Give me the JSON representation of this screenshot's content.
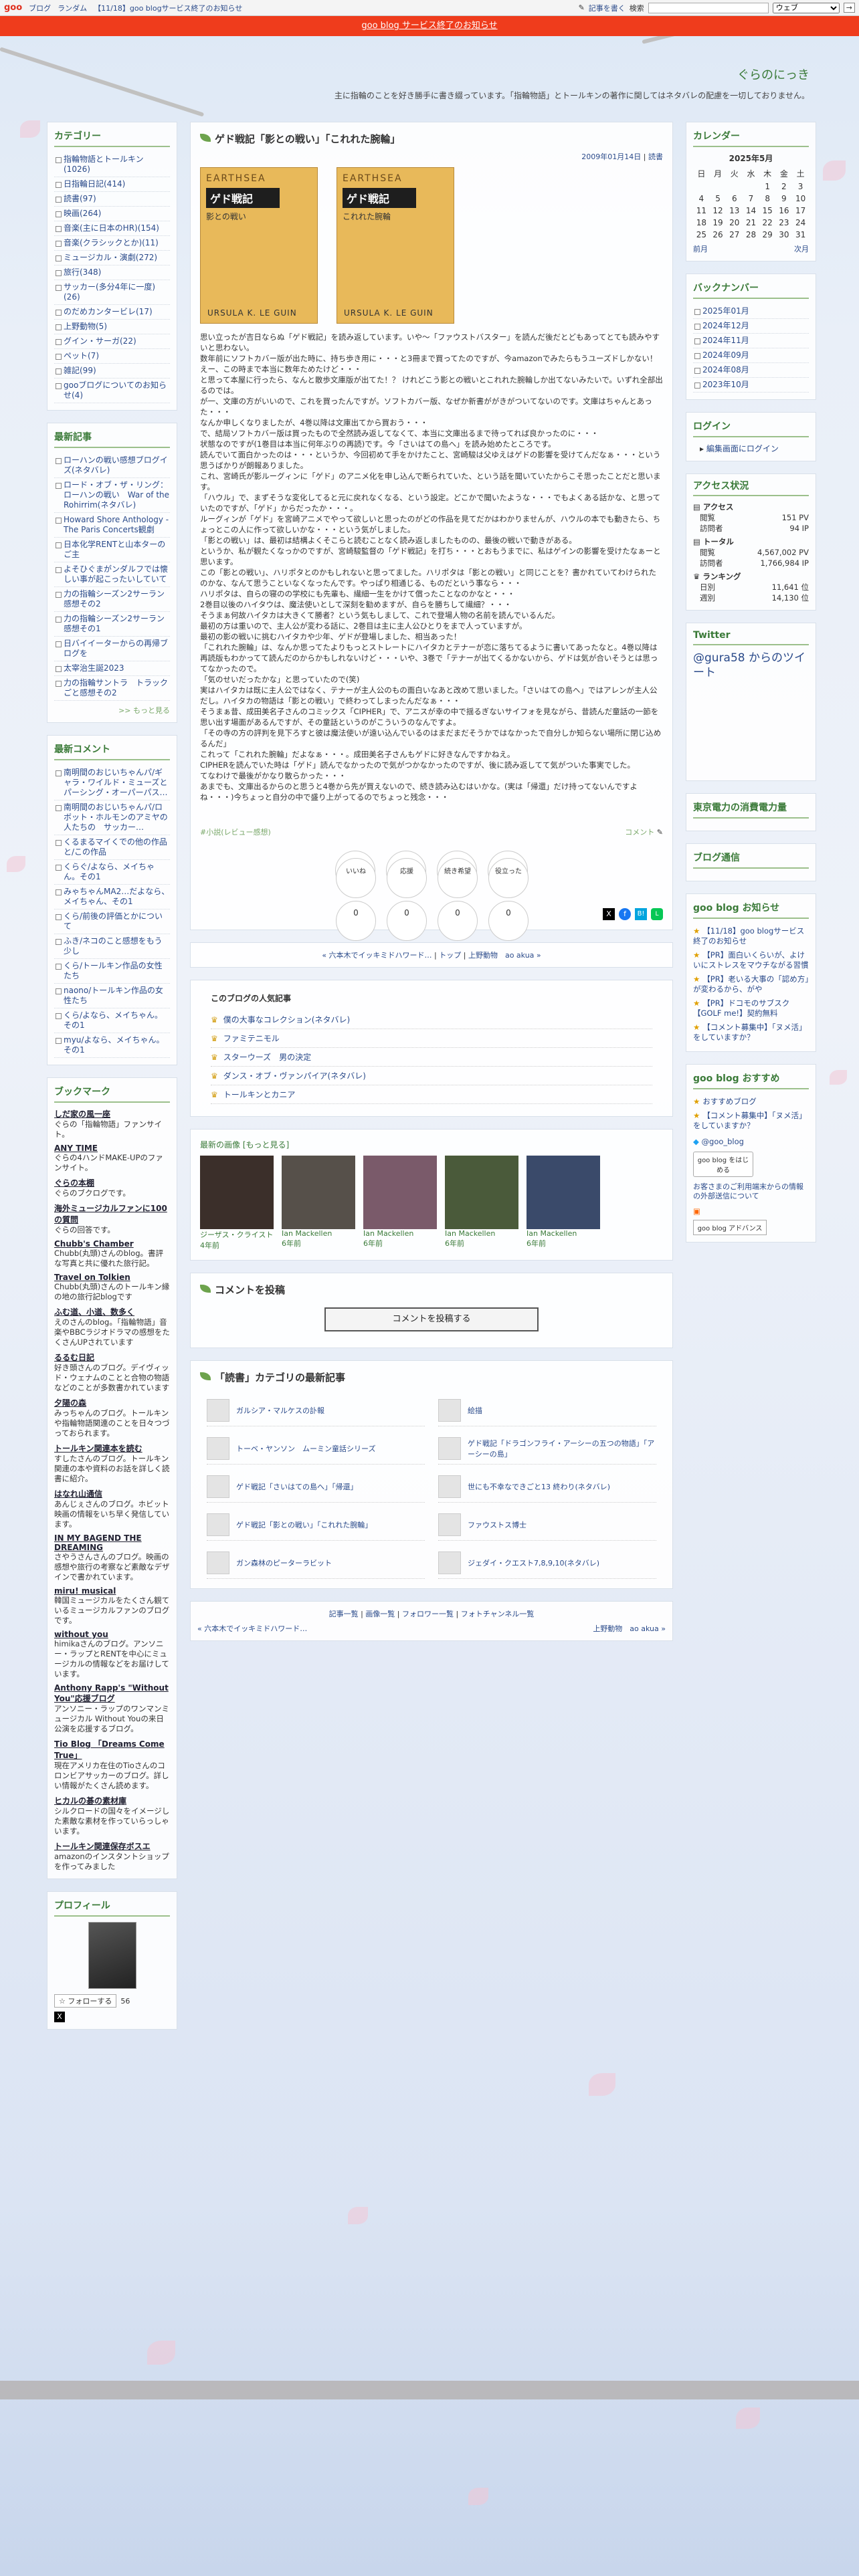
{
  "topbar": {
    "logo": "goo",
    "links": [
      "ブログ",
      "ランダム"
    ],
    "notice": "【11/18】goo blogサービス終了のお知らせ",
    "write": "記事を書く",
    "search_label": "検索",
    "search_scope": "ウェブ",
    "search_button": "→"
  },
  "banner": "goo blog サービス終了のお知らせ",
  "blog": {
    "title": "ぐらのにっき",
    "desc": "主に指輪のことを好き勝手に書き綴っています。「指輪物語」とトールキンの著作に関してはネタバレの配慮を一切しておりません。"
  },
  "categories": {
    "title": "カテゴリー",
    "items": [
      "指輪物語とトールキン(1026)",
      "日指輪日記(414)",
      "読書(97)",
      "映画(264)",
      "音楽(主に日本のHR)(154)",
      "音楽(クラシックとか)(11)",
      "ミュージカル・演劇(272)",
      "旅行(348)",
      "サッカー(多分4年に一度)(26)",
      "のだめカンタービレ(17)",
      "上野動物(5)",
      "グイン・サーガ(22)",
      "ペット(7)",
      "雑記(99)",
      "gooブログについてのお知らせ(4)"
    ]
  },
  "recent": {
    "title": "最新記事",
    "items": [
      "ローハンの戦い感想ブログイズ(ネタバレ)",
      "ロード・オブ・ザ・リング：ローハンの戦い　War of the Rohirrim(ネタバレ)",
      "Howard Shore Anthology -The Paris Concerts観劇",
      "日本化学RENTと山本ターのご主",
      "よそひぐまがンダルフでは懐しい事が起こったいしていて",
      "力の指輪シーズン2サーラン感想その2",
      "力の指輪シーズン2サーラン感想その1",
      "日バイイーターからの再帰ブログを",
      "太宰治生誕2023",
      "力の指輪サントラ　トラックごと感想その2"
    ],
    "more": ">> もっと見る"
  },
  "comments": {
    "title": "最新コメント",
    "items": [
      "南明間のおじいちゃんパ/ギャラ・ワイルド・ミューズとパーシング・オーパーパス…",
      "南明間のおじいちゃんパ/ロボット・ホルモンのアミヤの人たちの　サッカー…",
      "くるまるマイくでの他の作品と/この作品",
      "くらぐ/よなら、メイちゃん。その1",
      "みゃちゃんMA2…だよなら、メイちゃん、その1",
      "くら/前後の評価とかについて",
      "ふき/ネコのこと感想をもう少し",
      "くら/トールキン作品の女性たち",
      "naono/トールキン作品の女性たち",
      "くら/よなら、メイちゃん。その1",
      "myu/よなら、メイちゃん。その1"
    ]
  },
  "bookmarks": {
    "title": "ブックマーク",
    "items": [
      {
        "name": "しだ家の風一座",
        "desc": "ぐらの「指輪物語」ファンサイト。"
      },
      {
        "name": "ANY TIME",
        "desc": "ぐらの4ハンドMAKE-UPのファンサイト。"
      },
      {
        "name": "ぐらの本棚",
        "desc": "ぐらのブクログです。"
      },
      {
        "name": "海外ミュージカルファンに100の質問",
        "desc": "ぐらの回答です。"
      },
      {
        "name": "Chubb's Chamber",
        "desc": "Chubb(丸頭)さんのblog。書評な写真と共に優れた旅行記。"
      },
      {
        "name": "Travel on Tolkien",
        "desc": "Chubb(丸頭)さんのトールキン縁の地の旅行記blogです"
      },
      {
        "name": "ふむ道、小道、数多く",
        "desc": "えのさんのblog。「指輪物語」音楽やBBCラジオドラマの感想をたくさんUPされています"
      },
      {
        "name": "るるむ日記",
        "desc": "好き頭さんのブログ。デイヴィッド・ウェナムのことと合物の物語などのことが多数書かれています"
      },
      {
        "name": "夕陽の森",
        "desc": "みっちゃんのブログ。トールキンや指輪物語関連のことを日々つづっておられます。"
      },
      {
        "name": "トールキン関連本を読む",
        "desc": "すしたさんのブログ。トールキン関連の本や資料のお話を詳しく読書に紹介。"
      },
      {
        "name": "はなれ山通信",
        "desc": "あんじぇさんのブログ。ホビット映画の情報をいち早く発信しています。"
      },
      {
        "name": "IN MY BAGEND THE DREAMING",
        "desc": "さやうさんさんのブログ。映画の感想や旅行の考察など素敵なデザインで書かれています。"
      },
      {
        "name": "miru! musical",
        "desc": "韓国ミュージカルをたくさん観ているミュージカルファンのブログです。"
      },
      {
        "name": "without you",
        "desc": "himikaさんのブログ。アンソニー・ラップとRENTを中心にミュージカルの情報などをお届けしています。"
      },
      {
        "name": "Anthony Rapp's \"Without You\"応援ブログ",
        "desc": "アンソニー・ラップのワンマンミュージカル Without Youの来日公演を応援するブログ。"
      },
      {
        "name": "Tio Blog 「Dreams Come True」",
        "desc": "現在アメリカ在住のTioさんのコロンビアサッカーのブログ。詳しい情報がたくさん読めます。"
      },
      {
        "name": "ヒカルの碁の素材庫",
        "desc": "シルクロードの国々をイメージした素敵な素材を作っていらっしゃいます。"
      },
      {
        "name": "トールキン関連保存ボスエ",
        "desc": "amazonのインスタントショップを作ってみました"
      }
    ]
  },
  "profile": {
    "title": "プロフィール",
    "follow": "フォローする",
    "follow_count": "56"
  },
  "calendar": {
    "title": "カレンダー",
    "month": "2025年5月",
    "days": [
      "日",
      "月",
      "火",
      "水",
      "木",
      "金",
      "土"
    ],
    "weeks": [
      [
        "",
        "",
        "",
        "",
        "1",
        "2",
        "3"
      ],
      [
        "4",
        "5",
        "6",
        "7",
        "8",
        "9",
        "10"
      ],
      [
        "11",
        "12",
        "13",
        "14",
        "15",
        "16",
        "17"
      ],
      [
        "18",
        "19",
        "20",
        "21",
        "22",
        "23",
        "24"
      ],
      [
        "25",
        "26",
        "27",
        "28",
        "29",
        "30",
        "31"
      ]
    ],
    "prev": "前月",
    "next": "次月"
  },
  "backnumber": {
    "title": "バックナンバー",
    "items": [
      "2025年01月",
      "2024年12月",
      "2024年11月",
      "2024年09月",
      "2024年08月",
      "2023年10月"
    ]
  },
  "login": {
    "title": "ログイン",
    "link": "編集画面にログイン"
  },
  "access": {
    "title": "アクセス状況",
    "access_label": "アクセス",
    "pv_label": "閲覧",
    "pv": "151 PV",
    "uu_label": "訪問者",
    "uu": "94 IP",
    "total_label": "トータル",
    "total_pv": "4,567,002 PV",
    "total_uu": "1,766,984 IP",
    "rank_label": "ランキング",
    "daily_label": "日別",
    "daily": "11,641 位",
    "weekly_label": "週別",
    "weekly": "14,130 位"
  },
  "twitter": {
    "title": "Twitter",
    "link": "@gura58 からのツイート"
  },
  "power": {
    "title": "東京電力の消費電力量"
  },
  "blognotice": {
    "title": "ブログ通信"
  },
  "gooinfo": {
    "title": "goo blog お知らせ",
    "items": [
      "【11/18】goo blogサービス終了のお知らせ",
      "【PR】面白いくらいが、よけいにストレスをマウチながる習慣",
      "【PR】老いる大事の「認め方」が変わるから、がや",
      "【PR】ドコモのサブスク【GOLF me!】契約無料",
      "【コメント募集中】「ヌメ活」をしていますか？"
    ]
  },
  "goorec": {
    "title": "goo blog おすすめ",
    "items": [
      "おすすめブログ",
      "【コメント募集中】「ヌメ活」をしていますか？"
    ],
    "twitter": "@goo_blog",
    "button": "goo blog をはじめる",
    "privacy": "お客さまのご利用端末からの情報の外部送信について",
    "adv": "goo blog アドバンス"
  },
  "article": {
    "title": "ゲド戦記「影との戦い」「これれた腕輪」",
    "date": "2009年01月14日",
    "cat": "読書",
    "book1": {
      "title": "ゲド戦記",
      "sub": "影との戦い",
      "author": "URSULA K. LE GUIN",
      "series": "EARTHSEA"
    },
    "book2": {
      "title": "ゲド戦記",
      "sub": "これれた腕輪",
      "author": "URSULA K. LE GUIN",
      "series": "EARTHSEA"
    },
    "body": [
      "思い立ったが吉日ならぬ「ゲド戦記」を読み返しています。いや〜「ファウストバスター」を読んだ後だとどもあってとても読みやすいと思わない。",
      "数年前にソフトカバー版が出た時に、持ち歩き用に・・・と3冊まで買ってたのですが、今amazonでみたらもうユーズドしかない！えー、この時まで本当に数年ためたけど・・・",
      "と思って本屋に行ったら、なんと散歩文庫版が出てた！？ けれどこう影との戦いとこれれた腕輪しか出てないみたいで。いずれ全部出るのでは。",
      "が一、文庫の方がいいので、これを買ったんですが。ソフトカバー版、なぜか新書ががきがついてないのです。文庫はちゃんとあった・・・",
      "なんか申しくなりましたが、4巻以降は文庫出てから買おう・・・",
      "で、結局ソフトカバー版は買ったもので全然読み返してなくて、本当に文庫出るまで待ってれば良かったのに・・・",
      "状態なのですが(1巻目は本当に何年ぶりの再読)です。今「さいはての島へ」を読み始めたところです。",
      "読んでいて面白かったのは・・・というか、今回初めて手をかけたこと、宮崎駿は父ゆえはゲドの影響を受けてんだなぁ・・・という思うばかりが朗報ありました。",
      "これ、宮崎氏が影ルーグィンに「ゲド」のアニメ化を申し込んで断られていた、という話を聞いていたからこそ思ったことだと思います。",
      "「ハウル」で、まずそうな変化してると元に戻れなくなる、という設定。どこかで聞いたような・・・でもよくある話かな、と思っていたのですが、「ゲド」からだったか・・・。",
      "ルーグィンが「ゲド」を宮崎アニメでやって欲しいと思ったのがどの作品を見てだかはわかりませんが、ハウルの本でも動きたら、ちょっとこの人に作って欲しいかな・・・という気がしました。",
      "「影との戦い」は、最初は結構よくそこらと読むことなく読み返しましたものの、最後の戦いで動きがある。",
      "というか、私が観たくなっかのですが、宮崎駿監督の「ゲド戦記」を打ち・・・とおもうまでに、私はゲインの影響を受けたなぁーと思います。",
      "この「影との戦い」、ハリポタとのかもしれないと思ってました。ハリポタは「影との戦い」と同じことを？書かれていてわけられたのかな、なんて思うこといなくなったんです。やっぱり相通じる、ものだという事なら・・・",
      "ハリポタは、自らの寝のの学校にも先輩も、繊細一生をかけて償ったことなのかなと・・・",
      "2巻目以後のハイタウは、魔法使いとして深刻を勧めますが、自らを勝ちして繊細？・・・",
      "そうまぁ何故ハイタカは大きくて勝者？という気もしまして、これで登場人物の名前を読んでいるんだ。",
      "最初の方は重いので、主人公が変わる話に、2巻目は主に主人公ひとりをまで人っていますが。",
      "最初の影の戦いに挑むハイタカや少年、ゲドが登場しました、相当あった！",
      "「これれた腕輪」は、なんか思ってたよりもっとストレートにハイタカとテナーが恋に落ちてるように書いてあったなと。4巻以降は再読版もわかってて読んだのからかもしれないけど・・・いや、3巻で「テナーが出てくるかないから、ゲドは気が合いそうとは思ってなかったので。",
      "「気のせいだったかな」と思っていたので(笑)",
      "実はハイタカは既に主人公ではなく、テナーが主人公のもの面白いなあと改めて思いました。「さいはての島へ」ではアレンが主人公だし。ハイタカの物語は「影との戦い」で終わってしまったんだなぁ・・・",
      "そうまぁ昔、成田美名子さんのコミックス「CIPHER」で、アニスが幸の中で揺るぎないサイフォを見ながら、昔読んだ童話の一節を思い出す場面があるんですが、その童話というのがこういうのなんですよ。",
      "「その寺の方の評判を見下ろすと彼は魔法使いが遠い込んでいるのはまだまだそうかではなかったで自分しか知らない場所に閉じ込めるんだ」",
      "これって「これれた腕輪」だよなぁ・・・。成田美名子さんもゲドに好きなんですかねえ。",
      "CIPHERを読んでいた時は「ゲド」読んでなかったので気がつかなかったのですが、後に読み返してて気がついた事実でした。",
      "てなわけで最後がかなり散らかった・・・",
      "あまでも、文庫出るからのと思うと4巻から先が買えないので、続き読み込むはいかな。(実は「帰還」だけ持ってないんですよね・・・)今ちょっと自分の中で盛り上がってるのでちょっと残念・・・"
    ],
    "tag": "#小説(レビュー感想)",
    "comment_link": "コメント",
    "reactions": [
      {
        "label": "いいね",
        "count": "0"
      },
      {
        "label": "応援",
        "count": "0"
      },
      {
        "label": "続き希望",
        "count": "0"
      },
      {
        "label": "役立った",
        "count": "0"
      }
    ],
    "nav": {
      "prev": "« 六本木でイッキミドハワード…",
      "top": "トップ",
      "next": "上野動物　ao akua »"
    }
  },
  "popular": {
    "title": "このブログの人気記事",
    "items": [
      "僕の大事なコレクション(ネタバレ)",
      "ファミテニモル",
      "スターウーズ　男の決定",
      "ダンス・オブ・ヴァンパイア(ネタバレ)",
      "トールキンとカニア"
    ]
  },
  "latest": {
    "title": "最新の画像",
    "more": "[もっと見る]",
    "items": [
      {
        "label": "ジーザス・クライスト",
        "age": "4年前"
      },
      {
        "label": "Ian Mackellen",
        "age": "6年前"
      },
      {
        "label": "Ian Mackellen",
        "age": "6年前"
      },
      {
        "label": "Ian Mackellen",
        "age": "6年前"
      },
      {
        "label": "Ian Mackellen",
        "age": "6年前"
      }
    ]
  },
  "post": {
    "title": "コメントを投稿",
    "button": "コメントを投稿する"
  },
  "catnew": {
    "title": "「読書」カテゴリの最新記事",
    "items": [
      "ガルシア・マルケスの訃報",
      "絵描",
      "トーベ・ヤンソン　ムーミン童話シリーズ",
      "ゲド戦記「ドラゴンフライ・アーシーの五つの物語」「アーシーの島」",
      "ゲド戦記「さいはての島へ」「帰還」",
      "世にも不幸なできごと13 終わり(ネタバレ)",
      "ゲド戦記「影との戦い」「これれた腕輪」",
      "ファウストス博士",
      "ガン森林のピーターラビット",
      "ジェダイ・クエスト7,8,9,10(ネタバレ)"
    ]
  },
  "footer": {
    "links": [
      "記事一覧",
      "画像一覧",
      "フォロワー一覧",
      "フォトチャンネル一覧"
    ],
    "prev": "« 六本木でイッキミドハワード…",
    "next": "上野動物　ao akua »"
  }
}
